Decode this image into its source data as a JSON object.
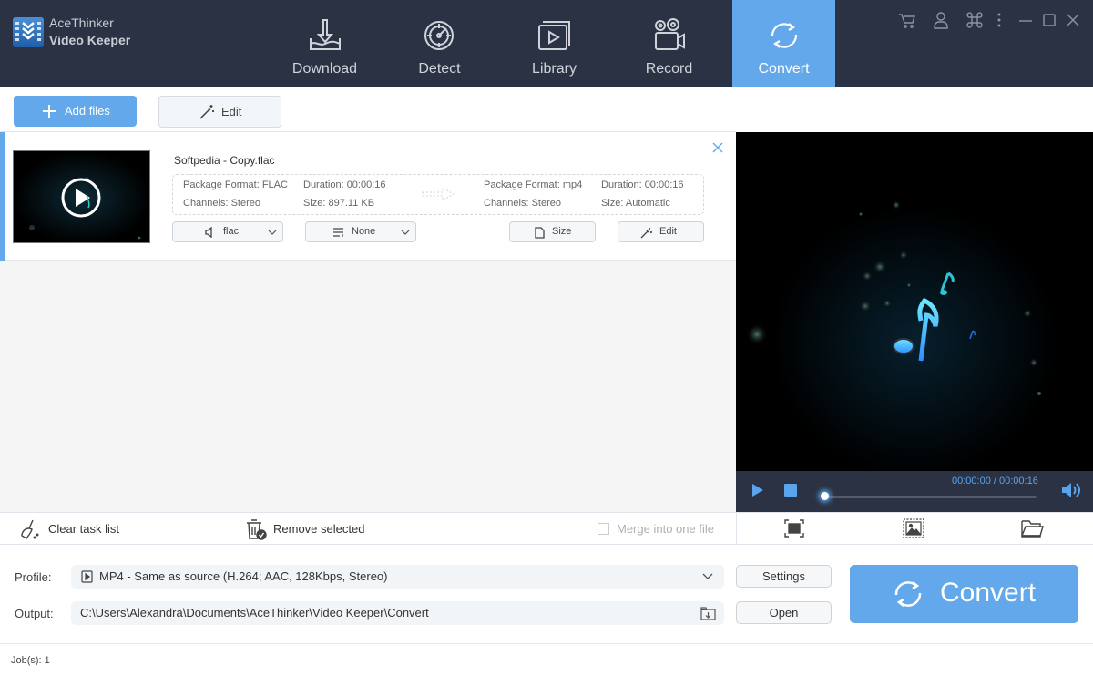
{
  "app": {
    "brand_line1": "AceThinker",
    "brand_line2": "Video Keeper"
  },
  "nav": {
    "tabs": [
      {
        "label": "Download",
        "icon": "download-icon",
        "active": false
      },
      {
        "label": "Detect",
        "icon": "detect-icon",
        "active": false
      },
      {
        "label": "Library",
        "icon": "library-icon",
        "active": false
      },
      {
        "label": "Record",
        "icon": "record-icon",
        "active": false
      },
      {
        "label": "Convert",
        "icon": "convert-icon",
        "active": true
      }
    ]
  },
  "window_controls": [
    "cart-icon",
    "user-icon",
    "command-icon",
    "more-icon",
    "minimize-icon",
    "maximize-icon",
    "close-icon"
  ],
  "toolbar": {
    "add_files": "Add files",
    "edit": "Edit"
  },
  "file": {
    "name": "Softpedia - Copy.flac",
    "source": {
      "package_format": "Package Format: FLAC",
      "duration": "Duration: 00:00:16",
      "channels": "Channels: Stereo",
      "size": "Size: 897.11 KB"
    },
    "target": {
      "package_format": "Package Format: mp4",
      "duration": "Duration: 00:00:16",
      "channels": "Channels: Stereo",
      "size": "Size: Automatic"
    },
    "audio_select": "flac",
    "subtitle_select": "None",
    "size_button": "Size",
    "edit_button": "Edit"
  },
  "player": {
    "time": "00:00:00 / 00:00:16",
    "progress": 0
  },
  "actions": {
    "clear": "Clear task list",
    "remove": "Remove selected",
    "merge": "Merge into one file",
    "merge_checked": false
  },
  "profile": {
    "label": "Profile:",
    "value": "MP4 - Same as source (H.264; AAC, 128Kbps, Stereo)",
    "settings": "Settings"
  },
  "output": {
    "label": "Output:",
    "value": "C:\\Users\\Alexandra\\Documents\\AceThinker\\Video Keeper\\Convert",
    "open": "Open"
  },
  "convert_button": "Convert",
  "status": {
    "jobs": "Job(s): 1"
  },
  "colors": {
    "accent": "#62a8ea",
    "header_bg": "#2b3244",
    "time_text": "#5aa4ee"
  }
}
